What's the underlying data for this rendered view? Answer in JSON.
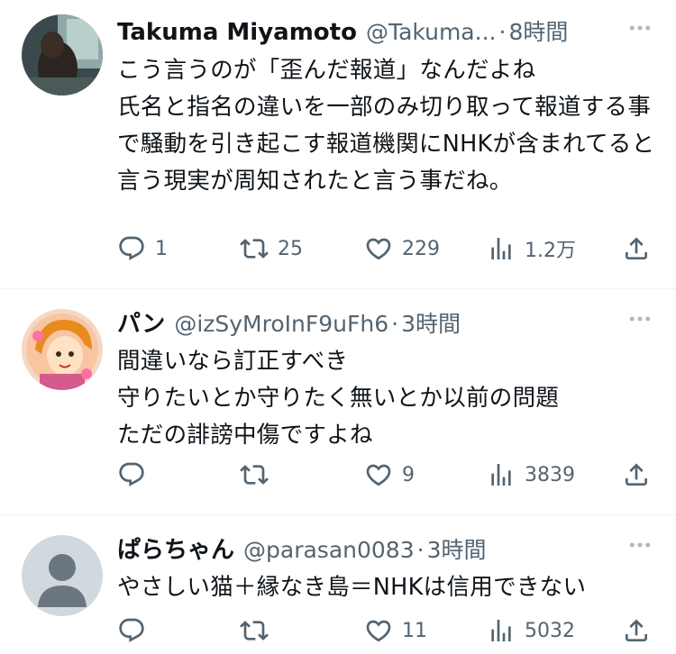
{
  "tweets": [
    {
      "name": "Takuma Miyamoto",
      "handle": "@Takuma...",
      "time": "8時間",
      "text": "こう言うのが「歪んだ報道」なんだよね\n氏名と指名の違いを一部のみ切り取って報道する事で騒動を引き起こす報道機関にNHKが含まれてると言う現実が周知されたと言う事だね。",
      "replies": "1",
      "retweets": "25",
      "likes": "229",
      "views": "1.2万"
    },
    {
      "name": "パン",
      "handle": "@izSyMroInF9uFh6",
      "time": "3時間",
      "text": "間違いなら訂正すべき\n守りたいとか守りたく無いとか以前の問題\nただの誹謗中傷ですよね",
      "replies": "",
      "retweets": "",
      "likes": "9",
      "views": "3839"
    },
    {
      "name": "ぱらちゃん",
      "handle": "@parasan0083",
      "time": "3時間",
      "text": "やさしい猫＋縁なき島＝NHKは信用できない",
      "replies": "",
      "retweets": "",
      "likes": "11",
      "views": "5032"
    }
  ],
  "separator": "·",
  "colors": {
    "text": "#0f1419",
    "secondary": "#536471",
    "divider": "#eff3f4"
  },
  "icons": [
    "reply-icon",
    "retweet-icon",
    "like-icon",
    "views-icon",
    "share-icon",
    "more-icon"
  ]
}
